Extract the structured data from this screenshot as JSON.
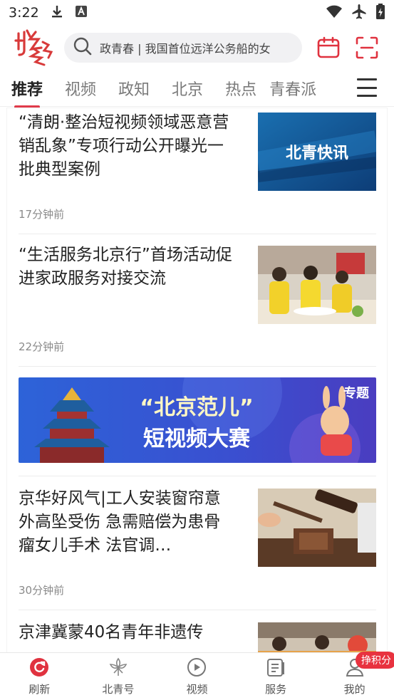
{
  "status_bar": {
    "time": "3:22",
    "icons": [
      "download-icon",
      "font-a-icon",
      "wifi-icon",
      "airplane-icon",
      "battery-icon"
    ]
  },
  "header": {
    "logo_text": "北青",
    "search_placeholder": "政青春 | 我国首位远洋公务船的女",
    "icons": [
      "calendar-icon",
      "scan-icon"
    ]
  },
  "tabs": [
    {
      "label": "推荐",
      "active": true
    },
    {
      "label": "视频",
      "active": false
    },
    {
      "label": "政知",
      "active": false
    },
    {
      "label": "北京",
      "active": false
    },
    {
      "label": "热点",
      "active": false
    },
    {
      "label": "青春派",
      "active": false
    }
  ],
  "articles": [
    {
      "title": "“清朗·整治短视频领域恶意营销乱象”专项行动公开曝光一批典型案例",
      "time": "17分钟前",
      "thumb_text": "北青快讯"
    },
    {
      "title": "“生活服务北京行”首场活动促进家政服务对接交流",
      "time": "22分钟前"
    },
    {
      "title": "京华好风气|工人安装窗帘意外高坠受伤 急需赔偿为患骨瘤女儿手术 法官调…",
      "time": "30分钟前"
    },
    {
      "title": "京津冀蒙40名青年非遗传"
    }
  ],
  "banner": {
    "tag": "专题",
    "headline": "“北京范儿”",
    "subline": "短视频大赛"
  },
  "bottom_nav": [
    {
      "label": "刷新",
      "icon": "refresh-icon"
    },
    {
      "label": "北青号",
      "icon": "flower-icon"
    },
    {
      "label": "视频",
      "icon": "play-icon"
    },
    {
      "label": "服务",
      "icon": "service-doc-icon"
    },
    {
      "label": "我的",
      "icon": "user-icon",
      "badge": "挣积分"
    }
  ],
  "colors": {
    "accent": "#e03a4a",
    "brand_red": "#e8323f",
    "text_primary": "#222222",
    "text_secondary": "#8a8a8a"
  }
}
